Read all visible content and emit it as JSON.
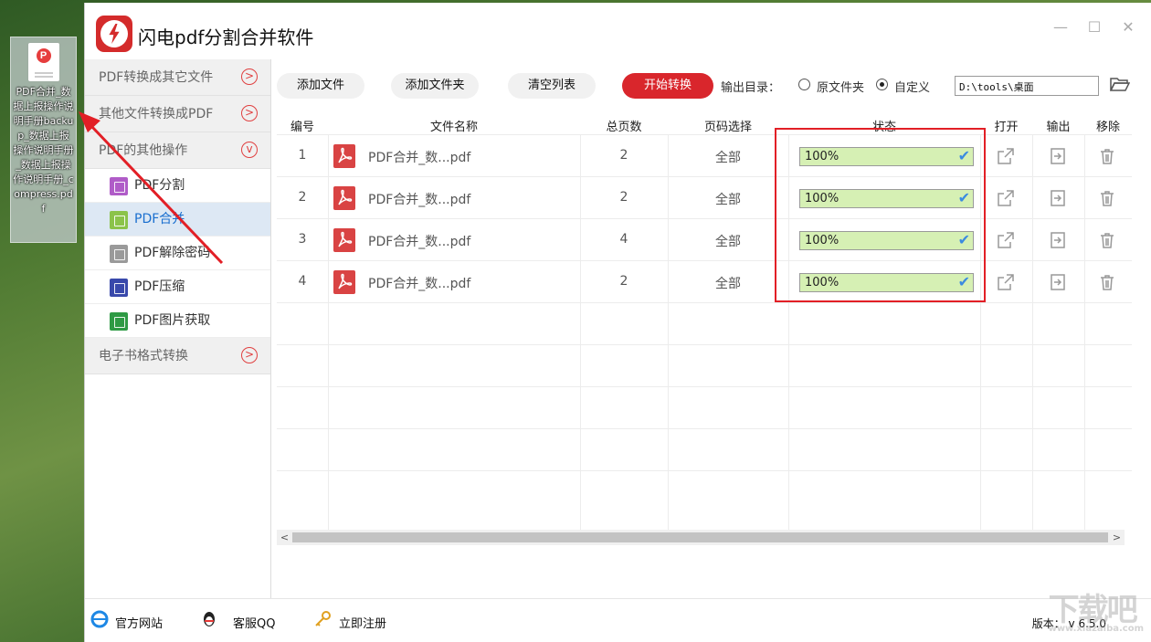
{
  "desktop": {
    "file_label": "PDF合并_数据上报操作说明手册backup_数据上报操作说明手册_数据上报操作说明手册_compress.pdf"
  },
  "app": {
    "title": "闪电pdf分割合并软件"
  },
  "window": {
    "minimize": "—",
    "maximize": "☐",
    "close": "✕"
  },
  "sidebar": {
    "groups": [
      {
        "label": "PDF转换成其它文件"
      },
      {
        "label": "其他文件转换成PDF"
      },
      {
        "label": "PDF的其他操作"
      }
    ],
    "items": [
      {
        "label": "PDF分割",
        "color": "#b05cc8"
      },
      {
        "label": "PDF合并",
        "color": "#8bc34a"
      },
      {
        "label": "PDF解除密码",
        "color": "#9a9a9a"
      },
      {
        "label": "PDF压缩",
        "color": "#3949ab"
      },
      {
        "label": "PDF图片获取",
        "color": "#2e9a44"
      }
    ],
    "last_group": {
      "label": "电子书格式转换"
    }
  },
  "toolbar": {
    "add_file": "添加文件",
    "add_folder": "添加文件夹",
    "clear_list": "清空列表",
    "start": "开始转换",
    "output_label": "输出目录：",
    "opt_original": "原文件夹",
    "opt_custom": "自定义",
    "path": "D:\\tools\\桌面"
  },
  "table": {
    "headers": {
      "no": "编号",
      "name": "文件名称",
      "pages": "总页数",
      "range": "页码选择",
      "status": "状态",
      "open": "打开",
      "output": "输出",
      "remove": "移除"
    },
    "rows": [
      {
        "no": "1",
        "name": "PDF合并_数...pdf",
        "pages": "2",
        "range": "全部",
        "status": "100%",
        "progress": 1.0
      },
      {
        "no": "2",
        "name": "PDF合并_数...pdf",
        "pages": "2",
        "range": "全部",
        "status": "100%",
        "progress": 1.0
      },
      {
        "no": "3",
        "name": "PDF合并_数...pdf",
        "pages": "4",
        "range": "全部",
        "status": "100%",
        "progress": 1.0
      },
      {
        "no": "4",
        "name": "PDF合并_数...pdf",
        "pages": "2",
        "range": "全部",
        "status": "100%",
        "progress": 1.0
      }
    ]
  },
  "footer": {
    "website": "官方网站",
    "qq": "客服QQ",
    "register": "立即注册",
    "version": "版本： v 6.5.0"
  },
  "watermark": {
    "text": "下载吧",
    "url": "www.xiazaiba.com"
  }
}
